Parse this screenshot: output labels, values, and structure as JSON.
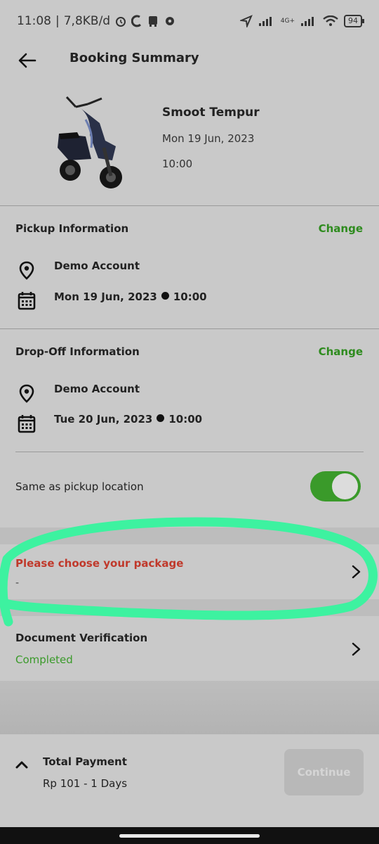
{
  "status_bar": {
    "time": "11:08",
    "speed": "7,8KB/d",
    "network": "4G+",
    "battery": "94"
  },
  "header": {
    "title": "Booking Summary",
    "back_icon": "arrow-left-icon"
  },
  "vehicle": {
    "name": "Smoot Tempur",
    "date": "Mon 19 Jun, 2023",
    "time": "10:00"
  },
  "pickup": {
    "title": "Pickup Information",
    "change_label": "Change",
    "location": "Demo Account",
    "date": "Mon 19 Jun, 2023",
    "time": "10:00"
  },
  "dropoff": {
    "title": "Drop-Off Information",
    "change_label": "Change",
    "location": "Demo Account",
    "date": "Tue 20 Jun, 2023",
    "time": "10:00",
    "same_as_pickup_label": "Same as pickup location",
    "same_as_pickup_enabled": true
  },
  "package": {
    "title": "Please choose your package",
    "value": "-"
  },
  "document": {
    "title": "Document Verification",
    "status": "Completed"
  },
  "footer": {
    "total_label": "Total Payment",
    "total_value": "Rp 101 - 1 Days",
    "continue_label": "Continue"
  },
  "colors": {
    "accent_green": "#2e8b1e",
    "warning_red": "#c0392b",
    "highlight": "#3df2a0"
  }
}
